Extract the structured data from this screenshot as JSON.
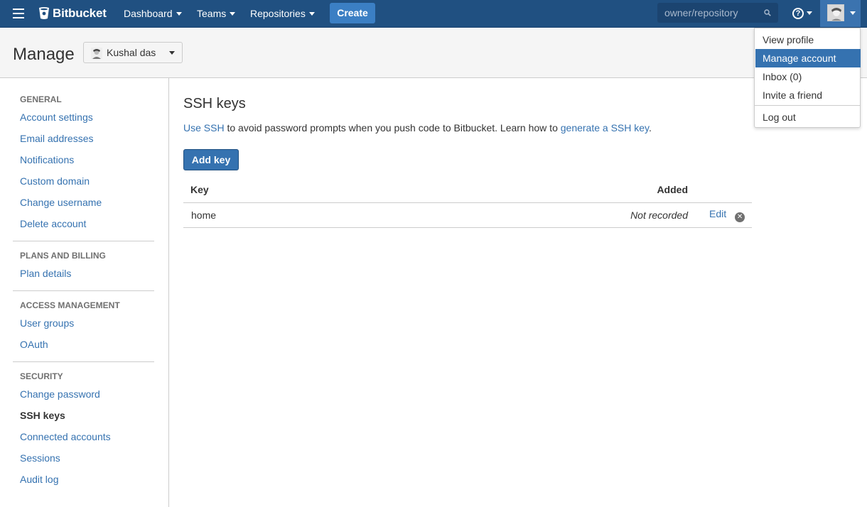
{
  "header": {
    "brand": "Bitbucket",
    "nav": [
      {
        "label": "Dashboard"
      },
      {
        "label": "Teams"
      },
      {
        "label": "Repositories"
      }
    ],
    "create_label": "Create",
    "search_placeholder": "owner/repository",
    "brand_color": "#205081"
  },
  "page": {
    "title": "Manage",
    "account_name": "Kushal das"
  },
  "sidebar": {
    "sections": [
      {
        "heading": "GENERAL",
        "items": [
          "Account settings",
          "Email addresses",
          "Notifications",
          "Custom domain",
          "Change username",
          "Delete account"
        ]
      },
      {
        "heading": "PLANS AND BILLING",
        "items": [
          "Plan details"
        ]
      },
      {
        "heading": "ACCESS MANAGEMENT",
        "items": [
          "User groups",
          "OAuth"
        ]
      },
      {
        "heading": "SECURITY",
        "items": [
          "Change password",
          "SSH keys",
          "Connected accounts",
          "Sessions",
          "Audit log"
        ]
      }
    ],
    "active_item": "SSH keys"
  },
  "main": {
    "title": "SSH keys",
    "intro_link1": "Use SSH",
    "intro_text": " to avoid password prompts when you push code to Bitbucket. Learn how to ",
    "intro_link2": "generate a SSH key",
    "intro_end": ".",
    "add_key_label": "Add key",
    "table": {
      "headers": [
        "Key",
        "Added"
      ],
      "rows": [
        {
          "key": "home",
          "added": "Not recorded",
          "edit": "Edit"
        }
      ]
    }
  },
  "user_menu": {
    "items": [
      "View profile",
      "Manage account",
      "Inbox (0)",
      "Invite a friend"
    ],
    "logout": "Log out",
    "highlighted": "Manage account"
  }
}
